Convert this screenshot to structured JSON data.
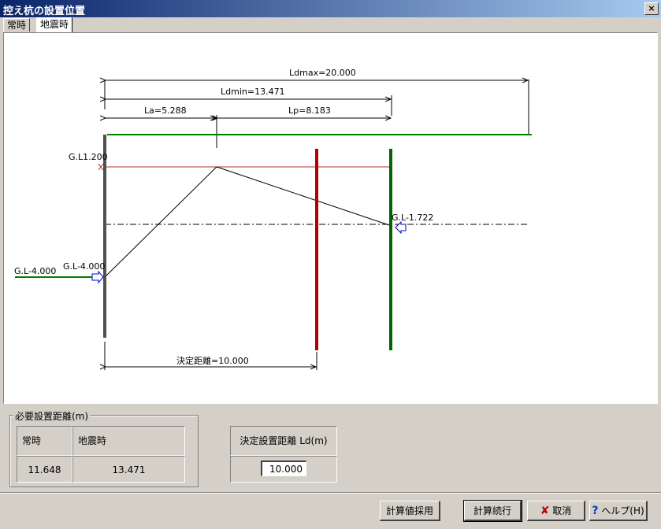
{
  "window": {
    "title": "控え杭の設置位置",
    "close_label": "×"
  },
  "tabs": {
    "normal": "常時",
    "earthquake": "地震時"
  },
  "diagram": {
    "ldmax": "Ldmax=20.000",
    "ldmin": "Ldmin=13.471",
    "la": "La=5.288",
    "lp": "Lp=8.183",
    "gl_top": "G.L1.200",
    "gl_left_outer": "G.L-4.000",
    "gl_left_inner": "G.L-4.000",
    "gl_right": "G.L-1.722",
    "decided_distance": "決定距離=10.000",
    "colors": {
      "ground": "#008000",
      "red_pile": "#b00000",
      "green_pile": "#006400",
      "wall": "#505050",
      "water": "#b03030"
    }
  },
  "required_distance": {
    "group_title": "必要設置距離(m)",
    "headers": [
      "常時",
      "地震時"
    ],
    "values": [
      "11.648",
      "13.471"
    ]
  },
  "decided": {
    "header": "決定設置距離 Ld(m)",
    "value": "10.000"
  },
  "buttons": {
    "adopt": "計算値採用",
    "continue": "計算続行",
    "cancel": "取消",
    "help": "ヘルプ(H)"
  }
}
